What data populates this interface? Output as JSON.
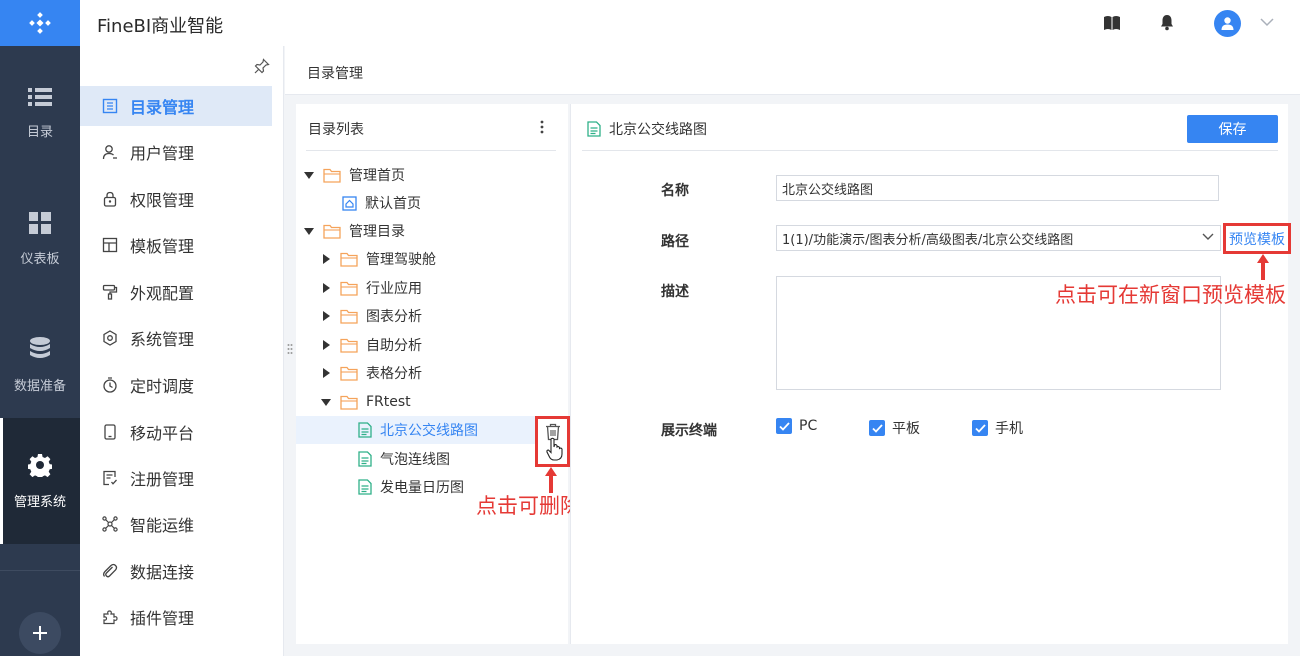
{
  "app": {
    "title": "FineBI商业智能"
  },
  "rail": {
    "items": [
      {
        "label": "目录"
      },
      {
        "label": "仪表板"
      },
      {
        "label": "数据准备"
      },
      {
        "label": "管理系统"
      }
    ]
  },
  "submenu": {
    "items": [
      {
        "label": "目录管理"
      },
      {
        "label": "用户管理"
      },
      {
        "label": "权限管理"
      },
      {
        "label": "模板管理"
      },
      {
        "label": "外观配置"
      },
      {
        "label": "系统管理"
      },
      {
        "label": "定时调度"
      },
      {
        "label": "移动平台"
      },
      {
        "label": "注册管理"
      },
      {
        "label": "智能运维"
      },
      {
        "label": "数据连接"
      },
      {
        "label": "插件管理"
      }
    ]
  },
  "breadcrumb": "目录管理",
  "tree": {
    "header": "目录列表",
    "nodes": [
      {
        "label": "管理首页"
      },
      {
        "label": "默认首页"
      },
      {
        "label": "管理目录"
      },
      {
        "label": "管理驾驶舱"
      },
      {
        "label": "行业应用"
      },
      {
        "label": "图表分析"
      },
      {
        "label": "自助分析"
      },
      {
        "label": "表格分析"
      },
      {
        "label": "FRtest"
      },
      {
        "label": "北京公交线路图"
      },
      {
        "label": "气泡连线图"
      },
      {
        "label": "发电量日历图"
      }
    ],
    "delete_tooltip": "删除"
  },
  "annotations": {
    "delete_hint": "点击可删除模板",
    "preview_hint": "点击可在新窗口预览模板"
  },
  "detail": {
    "title": "北京公交线路图",
    "save_label": "保存",
    "name_label": "名称",
    "name_value": "北京公交线路图",
    "path_label": "路径",
    "path_value": "1(1)/功能演示/图表分析/高级图表/北京公交线路图",
    "preview_label": "预览模板",
    "desc_label": "描述",
    "terminal_label": "展示终端",
    "terminals": [
      {
        "label": "PC",
        "checked": true
      },
      {
        "label": "平板",
        "checked": true
      },
      {
        "label": "手机",
        "checked": true
      }
    ]
  },
  "colors": {
    "accent": "#3685f2",
    "rail": "#2d3a4f",
    "annotation": "#e53935"
  }
}
